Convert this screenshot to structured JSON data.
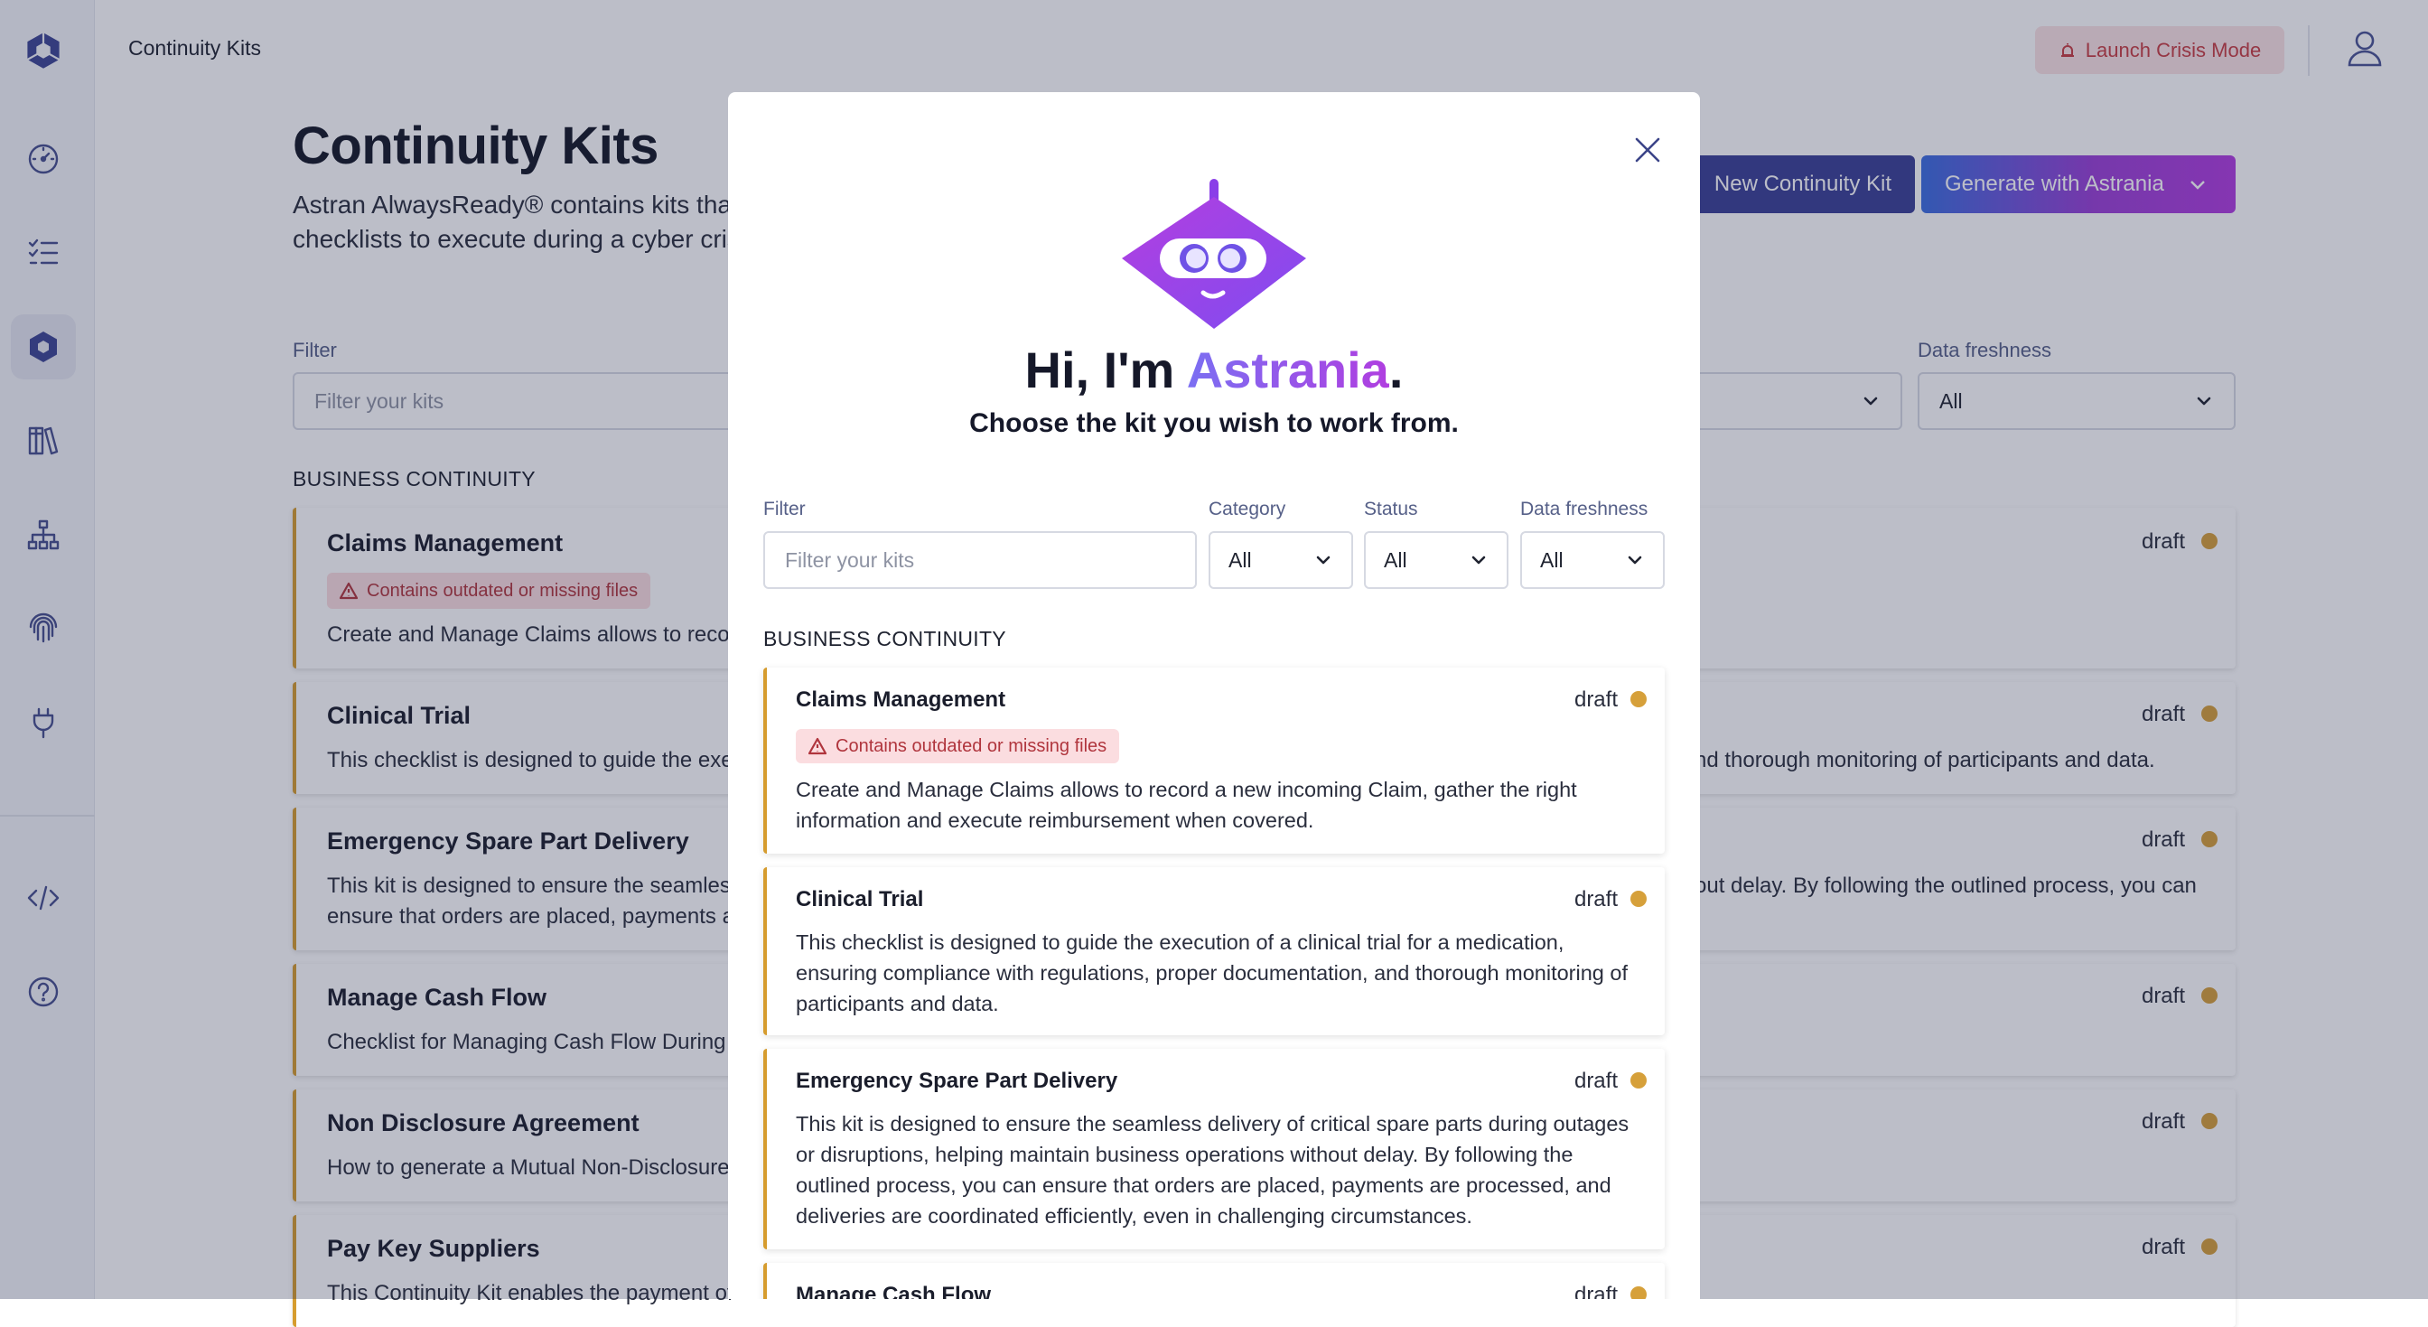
{
  "app": {
    "title": "Continuity Kits"
  },
  "topbar": {
    "crisis_label": "Launch Crisis Mode"
  },
  "sidebar": {
    "items": [
      {
        "icon": "dashboard-icon"
      },
      {
        "icon": "checklist-icon"
      },
      {
        "icon": "kits-icon",
        "active": true
      },
      {
        "icon": "library-icon"
      },
      {
        "icon": "org-chart-icon"
      },
      {
        "icon": "fingerprint-icon"
      },
      {
        "icon": "plug-icon"
      },
      {
        "icon": "code-icon"
      },
      {
        "icon": "help-icon"
      }
    ]
  },
  "page": {
    "title": "Continuity Kits",
    "desc_line1": "Astran AlwaysReady® contains kits that p",
    "desc_line2": "checklists to execute during a cyber crisi",
    "new_kit_label": "New Continuity Kit",
    "generate_label": "Generate with Astrania",
    "filter_label": "Filter",
    "filter_placeholder": "Filter your kits",
    "freshness_label": "Data freshness",
    "freshness_value": "All",
    "section": "BUSINESS CONTINUITY",
    "cards": [
      {
        "title": "Claims Management",
        "status": "draft",
        "badge": "Contains outdated or missing files",
        "desc_left": "Create and Manage Claims allows to record",
        "desc_right": ""
      },
      {
        "title": "Clinical Trial",
        "status": "draft",
        "desc_left": "This checklist is designed to guide the exec",
        "desc_right": "nd thorough monitoring of participants and data."
      },
      {
        "title": "Emergency Spare Part Delivery",
        "status": "draft",
        "desc_left": "This kit is designed to ensure the seamless",
        "desc_left2": "ensure that orders are placed, payments ar",
        "desc_right": "out delay. By following the outlined process, you can"
      },
      {
        "title": "Manage Cash Flow",
        "status": "draft",
        "desc_left": "Checklist for Managing Cash Flow During a",
        "desc_right": ""
      },
      {
        "title": "Non Disclosure Agreement",
        "status": "draft",
        "desc_left": "How to generate a Mutual Non-Disclosure A",
        "desc_right": ""
      },
      {
        "title": "Pay Key Suppliers",
        "status": "draft",
        "desc_left": "This Continuity Kit enables the payment of",
        "desc_right": ""
      }
    ]
  },
  "modal": {
    "greeting_prefix": "Hi, I'm ",
    "greeting_brand": "Astrania",
    "greeting_suffix": ".",
    "subtitle": "Choose the kit you wish to work from.",
    "filter_label": "Filter",
    "filter_placeholder": "Filter your kits",
    "category_label": "Category",
    "category_value": "All",
    "status_label": "Status",
    "status_value": "All",
    "freshness_label": "Data freshness",
    "freshness_value": "All",
    "section": "BUSINESS CONTINUITY",
    "cards": [
      {
        "title": "Claims Management",
        "status": "draft",
        "badge": "Contains outdated or missing files",
        "desc": "Create and Manage Claims allows to record a new incoming Claim, gather the right information and execute reimbursement when covered."
      },
      {
        "title": "Clinical Trial",
        "status": "draft",
        "desc": "This checklist is designed to guide the execution of a clinical trial for a medication, ensuring compliance with regulations, proper documentation, and thorough monitoring of participants and data."
      },
      {
        "title": "Emergency Spare Part Delivery",
        "status": "draft",
        "desc": "This kit is designed to ensure the seamless delivery of critical spare parts during outages or disruptions, helping maintain business operations without delay. By following the outlined process, you can ensure that orders are placed, payments are processed, and deliveries are coordinated efficiently, even in challenging circumstances."
      },
      {
        "title": "Manage Cash Flow",
        "status": "draft"
      }
    ]
  },
  "colors": {
    "accent": "#3a3f96",
    "status_draft": "#d6a03a",
    "warning": "#b0353d"
  }
}
